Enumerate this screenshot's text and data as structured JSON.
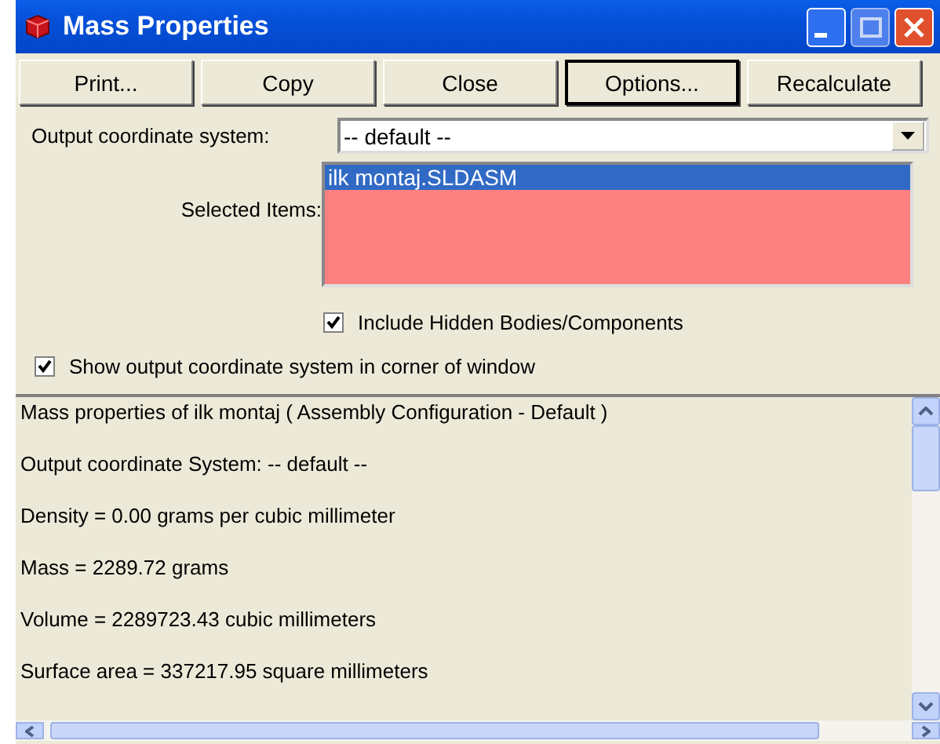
{
  "window": {
    "title": "Mass Properties"
  },
  "buttons": [
    {
      "label": "Print...",
      "focused": false
    },
    {
      "label": "Copy",
      "focused": false
    },
    {
      "label": "Close",
      "focused": false
    },
    {
      "label": "Options...",
      "focused": true
    },
    {
      "label": "Recalculate",
      "focused": false
    }
  ],
  "coordinate_system": {
    "label": "Output coordinate system:",
    "value": "-- default --"
  },
  "selected_items": {
    "label": "Selected Items:",
    "items": [
      {
        "text": "ilk montaj.SLDASM",
        "selected": true
      }
    ]
  },
  "checkboxes": [
    {
      "label": "Include Hidden Bodies/Components",
      "checked": true,
      "indented": true
    },
    {
      "label": "Show output coordinate system in corner of window",
      "checked": true,
      "indented": false
    }
  ],
  "results": [
    "Mass properties of ilk montaj ( Assembly Configuration - Default )",
    "Output  coordinate System: -- default --",
    "Density = 0.00 grams per cubic millimeter",
    "Mass = 2289.72 grams",
    "Volume = 2289723.43 cubic millimeters",
    "Surface area = 337217.95 square millimeters"
  ]
}
